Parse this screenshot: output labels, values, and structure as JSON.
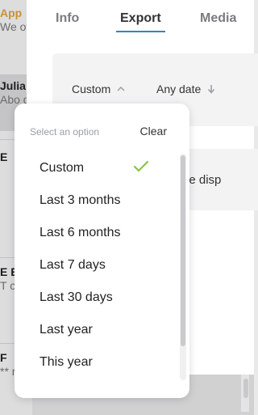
{
  "background_list": {
    "items": [
      {
        "title": "App",
        "subtitle": "We offi"
      },
      {
        "title": "Julia",
        "subtitle": "Abo gr"
      },
      {
        "title": "E",
        "subtitle": ""
      },
      {
        "title": "E E",
        "subtitle": "T c"
      },
      {
        "title": "F",
        "subtitle": "** m"
      }
    ]
  },
  "tabs": [
    {
      "label": "Info"
    },
    {
      "label": "Export"
    },
    {
      "label": "Media"
    }
  ],
  "filters": {
    "period_label": "Custom",
    "date_label": "Any date"
  },
  "info_text": "will be disp",
  "dropdown": {
    "placeholder": "Select an option",
    "clear_label": "Clear",
    "selected": "Custom",
    "options": [
      "Custom",
      "Last 3 months",
      "Last 6 months",
      "Last 7 days",
      "Last 30 days",
      "Last year",
      "This year"
    ]
  },
  "colors": {
    "accent": "#3c83b8",
    "check": "#8bc34a",
    "highlight": "#e2a23a"
  }
}
